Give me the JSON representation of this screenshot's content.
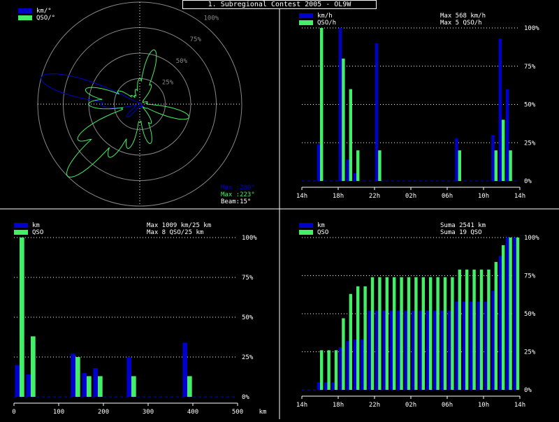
{
  "title": "1. Subregional Contest 2005 - OL9W",
  "colors": {
    "blue": "#0000cc",
    "green": "#44ee66",
    "grid": "#ffffff",
    "ring": "#888888"
  },
  "chart_data": [
    {
      "type": "polar",
      "legend": [
        "km/°",
        "QSO/°"
      ],
      "ring_labels": [
        "25%",
        "50%",
        "75%",
        "100%"
      ],
      "info": [
        "Max :280°",
        "Max :223°",
        "Beam:15°"
      ],
      "beam_deg": 15,
      "series": [
        {
          "name": "km/°",
          "color": "blue",
          "azimuths": [
            0,
            15,
            30,
            45,
            60,
            75,
            90,
            105,
            120,
            135,
            150,
            165,
            180,
            195,
            210,
            225,
            240,
            255,
            270,
            285,
            300,
            315,
            330,
            345
          ],
          "values": [
            0,
            0,
            0,
            0,
            0,
            0,
            0,
            0.02,
            0.03,
            0.04,
            0.04,
            0.03,
            0.02,
            0.03,
            0.05,
            0.18,
            0.06,
            0.04,
            0.38,
            1.0,
            0.05,
            0.03,
            0.02,
            0.01
          ]
        },
        {
          "name": "QSO/°",
          "color": "green",
          "azimuths": [
            0,
            15,
            30,
            45,
            60,
            75,
            90,
            105,
            120,
            135,
            150,
            165,
            180,
            195,
            210,
            225,
            240,
            255,
            270,
            285,
            300,
            315,
            330,
            345
          ],
          "values": [
            0.25,
            0.55,
            0.22,
            0.05,
            0.04,
            0.08,
            0.08,
            0.5,
            0.08,
            0.05,
            0.22,
            0.4,
            0.18,
            0.45,
            0.6,
            1.0,
            0.7,
            0.18,
            0.5,
            0.55,
            0.25,
            0.12,
            0.1,
            0.15
          ]
        }
      ]
    },
    {
      "type": "bar",
      "legend": [
        "km/h",
        "QSO/h"
      ],
      "stats": [
        "Max   568 km/h",
        "Max    5 QSO/h"
      ],
      "x_ticks": [
        "14h",
        "18h",
        "22h",
        "02h",
        "06h",
        "10h",
        "14h"
      ],
      "y_ticks": [
        "0%",
        "25%",
        "50%",
        "75%",
        "100%"
      ],
      "series": [
        {
          "name": "km/h",
          "color": "blue",
          "values": [
            0,
            0,
            0.24,
            0,
            0,
            1.0,
            0.14,
            0.05,
            0,
            0,
            0.9,
            0,
            0,
            0,
            0,
            0,
            0,
            0,
            0,
            0,
            0,
            0.28,
            0,
            0,
            0,
            0,
            0.3,
            0.93,
            0.6,
            0
          ]
        },
        {
          "name": "QSO/h",
          "color": "green",
          "values": [
            0,
            0,
            1.0,
            0,
            0,
            0.8,
            0.6,
            0.2,
            0,
            0,
            0.2,
            0,
            0,
            0,
            0,
            0,
            0,
            0,
            0,
            0,
            0,
            0.2,
            0,
            0,
            0,
            0,
            0.2,
            0.4,
            0.2,
            0
          ]
        }
      ]
    },
    {
      "type": "bar",
      "legend": [
        "km",
        "QSO"
      ],
      "stats": [
        "Max  1009 km/25 km",
        "Max    8 QSO/25 km"
      ],
      "x_ticks": [
        "0",
        "100",
        "200",
        "300",
        "400",
        "500"
      ],
      "x_unit": "km",
      "y_ticks": [
        "0%",
        "25%",
        "50%",
        "75%",
        "100%"
      ],
      "series": [
        {
          "name": "km",
          "color": "blue",
          "values": [
            0.2,
            0.14,
            0,
            0,
            0,
            0.27,
            0.15,
            0.18,
            0,
            0,
            0.25,
            0,
            0,
            0,
            0,
            0.34,
            0,
            0,
            0,
            0
          ]
        },
        {
          "name": "QSO",
          "color": "green",
          "values": [
            1.0,
            0.38,
            0,
            0,
            0,
            0.25,
            0.13,
            0.13,
            0,
            0,
            0.13,
            0,
            0,
            0,
            0,
            0.13,
            0,
            0,
            0,
            0
          ]
        }
      ]
    },
    {
      "type": "bar",
      "legend": [
        "km",
        "QSO"
      ],
      "stats": [
        "Suma   2541 km",
        "Suma    19 QSO"
      ],
      "x_ticks": [
        "14h",
        "18h",
        "22h",
        "02h",
        "06h",
        "10h",
        "14h"
      ],
      "y_ticks": [
        "0%",
        "25%",
        "50%",
        "75%",
        "100%"
      ],
      "series": [
        {
          "name": "km",
          "color": "blue",
          "values": [
            0,
            0,
            0.05,
            0.05,
            0.05,
            0.28,
            0.32,
            0.33,
            0.33,
            0.52,
            0.52,
            0.52,
            0.52,
            0.52,
            0.52,
            0.52,
            0.52,
            0.52,
            0.52,
            0.52,
            0.52,
            0.58,
            0.58,
            0.58,
            0.58,
            0.58,
            0.65,
            0.88,
            1.0,
            1.0
          ]
        },
        {
          "name": "QSO",
          "color": "green",
          "values": [
            0,
            0,
            0.26,
            0.26,
            0.26,
            0.47,
            0.63,
            0.68,
            0.68,
            0.74,
            0.74,
            0.74,
            0.74,
            0.74,
            0.74,
            0.74,
            0.74,
            0.74,
            0.74,
            0.74,
            0.74,
            0.79,
            0.79,
            0.79,
            0.79,
            0.79,
            0.84,
            0.95,
            1.0,
            1.0
          ]
        }
      ]
    }
  ]
}
